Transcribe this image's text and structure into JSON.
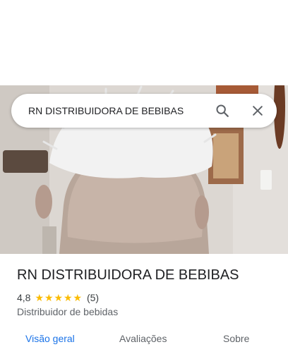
{
  "search": {
    "query": "RN DISTRIBUIDORA DE BEBIBAS"
  },
  "place": {
    "name": "RN DISTRIBUIDORA DE BEBIBAS",
    "rating": "4,8",
    "stars": 5,
    "review_count": "(5)",
    "category": "Distribuidor de bebidas"
  },
  "tabs": [
    {
      "label": "Visão geral",
      "active": true
    },
    {
      "label": "Avaliações",
      "active": false
    },
    {
      "label": "Sobre",
      "active": false
    }
  ],
  "colors": {
    "accent": "#1a73e8",
    "star": "#fbbc04",
    "text_primary": "#202124",
    "text_secondary": "#5f6368"
  },
  "icons": [
    "search-icon",
    "close-icon",
    "star-icon"
  ]
}
